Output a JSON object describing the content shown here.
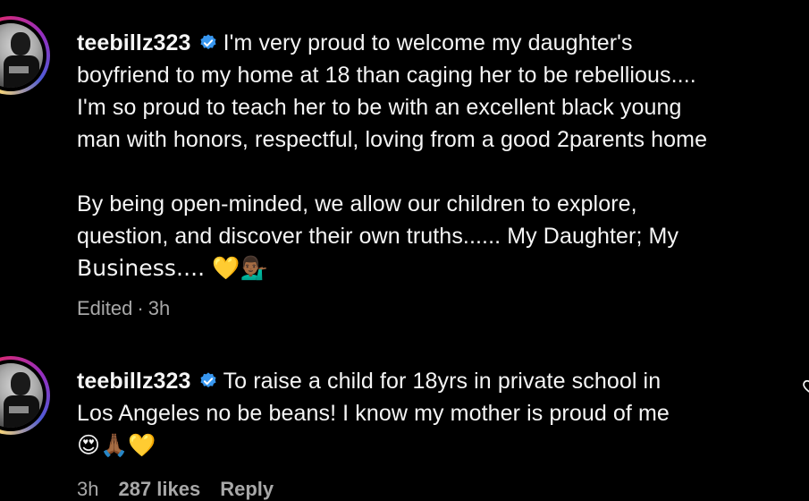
{
  "comments": [
    {
      "username": "teebillz323",
      "verified": true,
      "lines": [
        "I'm very proud to welcome my daughter's",
        "boyfriend to my home at 18 than caging her to be rebellious....",
        "I'm so proud to teach her to be with an excellent black young",
        "man with honors, respectful, loving from a good 2parents home",
        "",
        "By being open-minded, we allow our children to explore,",
        "question, and discover their own truths...... My Daughter; My",
        "Business.... 💛💁🏾‍♂️"
      ],
      "edited_label": "Edited",
      "time": "3h"
    },
    {
      "username": "teebillz323",
      "verified": true,
      "lines": [
        "To raise a child for 18yrs in private school in",
        "Los Angeles no be beans! I know my mother is proud of me",
        "😍🙏🏾💛"
      ],
      "time": "3h",
      "likes": "287 likes",
      "reply_label": "Reply"
    }
  ],
  "icons": {
    "verified": "verified-badge-icon",
    "like": "heart-outline-icon"
  },
  "colors": {
    "background": "#000000",
    "text": "#f5f5f5",
    "muted": "#a8a8a8",
    "verified": "#3897f0"
  }
}
